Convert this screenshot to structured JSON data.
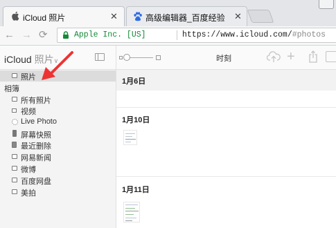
{
  "browser": {
    "tabs": [
      {
        "title": "iCloud 照片",
        "active": true
      },
      {
        "title": "高级编辑器_百度经验",
        "active": false
      }
    ],
    "address": {
      "secure_label": "Apple Inc. [US]",
      "url_host": "https://www.icloud.com/",
      "url_path": "#photos"
    }
  },
  "app": {
    "brand": "iCloud",
    "section": "照片",
    "view_title": "时刻"
  },
  "sidebar": {
    "top_item": {
      "label": "照片",
      "icon": "photos-icon",
      "selected": true
    },
    "section_header": "相簿",
    "albums": [
      {
        "label": "所有照片",
        "icon": "album-icon"
      },
      {
        "label": "视频",
        "icon": "video-icon"
      },
      {
        "label": "Live Photo",
        "icon": "live-photo-icon"
      },
      {
        "label": "屏幕快照",
        "icon": "screenshot-icon"
      },
      {
        "label": "最近删除",
        "icon": "trash-icon"
      },
      {
        "label": "网易新闻",
        "icon": "album-icon"
      },
      {
        "label": "微博",
        "icon": "album-icon"
      },
      {
        "label": "百度网盘",
        "icon": "album-icon"
      },
      {
        "label": "美拍",
        "icon": "album-icon"
      }
    ]
  },
  "moments": [
    {
      "date": "1月6日"
    },
    {
      "date": "1月10日"
    },
    {
      "date": "1月11日"
    }
  ],
  "colors": {
    "arrow": "#ee3333",
    "secure_green": "#138a36",
    "baidu_blue": "#2e6be6"
  }
}
